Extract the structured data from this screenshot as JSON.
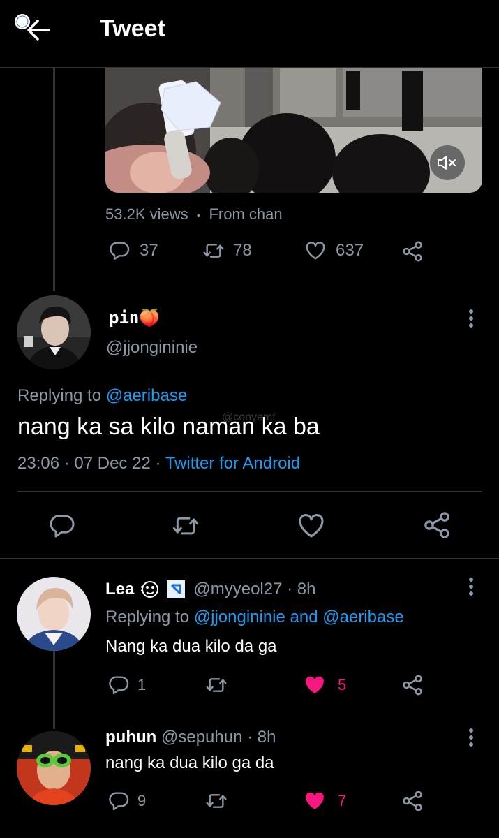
{
  "header": {
    "title": "Tweet"
  },
  "video_tweet": {
    "views": "53.2K views",
    "separator": "•",
    "from": "From chan",
    "replies": "37",
    "retweets": "78",
    "likes": "637"
  },
  "main_tweet": {
    "display_name": "pin🍑",
    "handle": "@jjongininie",
    "replying_prefix": "Replying to",
    "replying_to": "@aeribase",
    "text": "nang ka sa kilo naman ka ba",
    "watermark": "@conyemf",
    "timestamp": "23:06 · 07 Dec 22 ·",
    "source": "Twitter for Android"
  },
  "replies": [
    {
      "display_name": "Lea",
      "handle_time": "@myyeol27 · 8h",
      "replying_prefix": "Replying to",
      "replying_to": "@jjongininie and @aeribase",
      "text": "Nang ka dua kilo da ga",
      "reply_count": "1",
      "like_count": "5"
    },
    {
      "display_name": "puhun",
      "handle_time": "@sepuhun · 8h",
      "text": "nang ka dua kilo ga da",
      "reply_count": "9",
      "like_count": "7"
    }
  ],
  "colors": {
    "background": "#000000",
    "link": "#1d9bf0",
    "muted": "#8b98a5",
    "like_active": "#f91880",
    "divider": "#2f3336"
  },
  "icons": [
    "back-arrow-icon",
    "reply-icon",
    "retweet-icon",
    "like-icon",
    "share-icon",
    "more-icon",
    "mute-icon"
  ]
}
